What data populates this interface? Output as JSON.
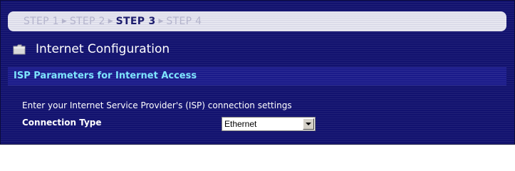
{
  "wizard": {
    "steps": [
      {
        "label": "STEP 1",
        "state": "inactive"
      },
      {
        "label": "STEP 2",
        "state": "inactive"
      },
      {
        "label": "STEP 3",
        "state": "active"
      },
      {
        "label": "STEP 4",
        "state": "inactive"
      }
    ],
    "separator_icon": "triangle-right-icon"
  },
  "page": {
    "title": "Internet Configuration",
    "title_icon": "folder-icon"
  },
  "section": {
    "header": "ISP Parameters for Internet Access",
    "description": "Enter your Internet Service Provider's (ISP) connection settings"
  },
  "form": {
    "connection_type_label": "Connection Type",
    "connection_type_value": "Ethernet"
  },
  "colors": {
    "panel_bg": "#12126f",
    "section_header_text": "#7ee5ff",
    "active_step": "#1d1d6e",
    "inactive_step": "#b4b4cc"
  }
}
